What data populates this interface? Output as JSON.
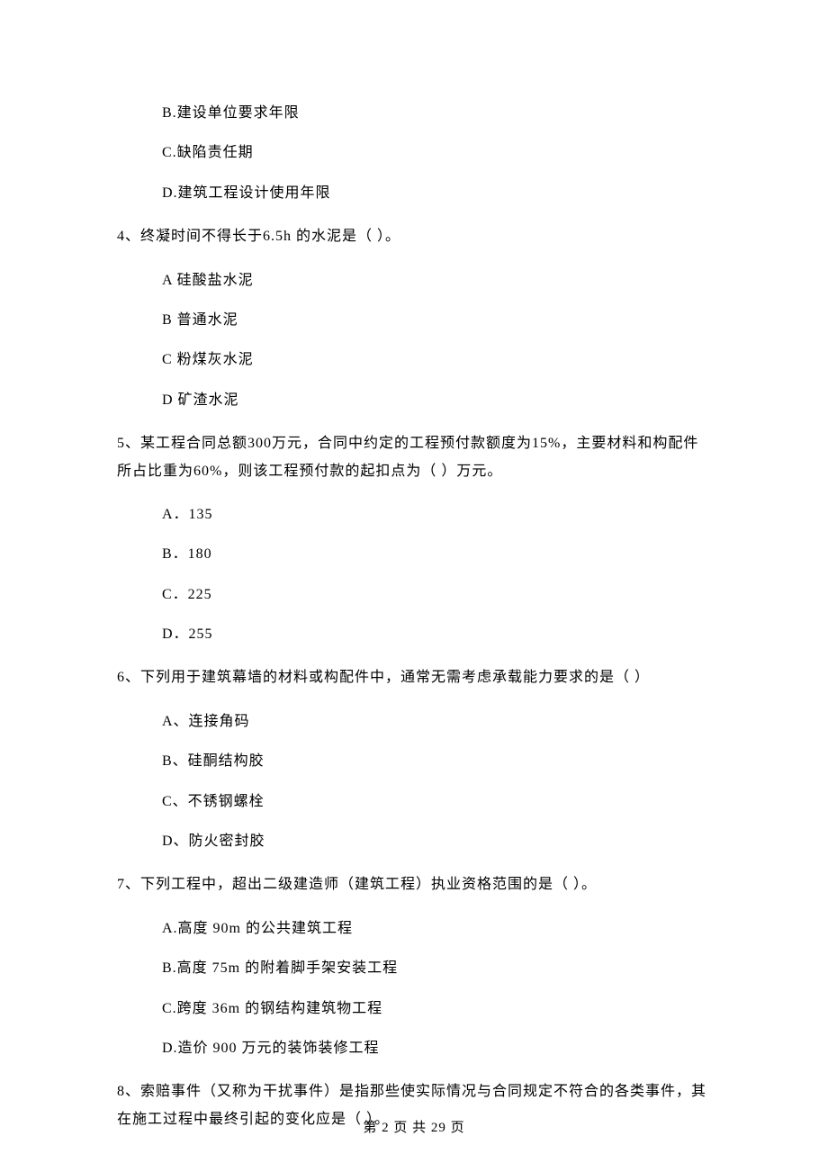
{
  "q3_options": {
    "b": "B.建设单位要求年限",
    "c": "C.缺陷责任期",
    "d": "D.建筑工程设计使用年限"
  },
  "q4": {
    "stem": "4、终凝时间不得长于6.5h 的水泥是（  ）。",
    "a": "A 硅酸盐水泥",
    "b": "B 普通水泥",
    "c": "C 粉煤灰水泥",
    "d": "D 矿渣水泥"
  },
  "q5": {
    "stem": "5、某工程合同总额300万元，合同中约定的工程预付款额度为15%，主要材料和构配件所占比重为60%，则该工程预付款的起扣点为（    ）万元。",
    "a": "A．135",
    "b": "B．180",
    "c": "C．225",
    "d": "D．255"
  },
  "q6": {
    "stem": "6、下列用于建筑幕墙的材料或构配件中，通常无需考虑承载能力要求的是（    ）",
    "a": "A、连接角码",
    "b": "B、硅酮结构胶",
    "c": "C、不锈钢螺栓",
    "d": "D、防火密封胶"
  },
  "q7": {
    "stem": "7、下列工程中，超出二级建造师（建筑工程）执业资格范围的是（  ）。",
    "a": "A.高度 90m 的公共建筑工程",
    "b": "B.高度 75m 的附着脚手架安装工程",
    "c": "C.跨度 36m 的钢结构建筑物工程",
    "d": "D.造价 900 万元的装饰装修工程"
  },
  "q8": {
    "stem": "8、索赔事件（又称为干扰事件）是指那些使实际情况与合同规定不符合的各类事件，其在施工过程中最终引起的变化应是（  ）。"
  },
  "footer": "第 2 页 共 29 页"
}
